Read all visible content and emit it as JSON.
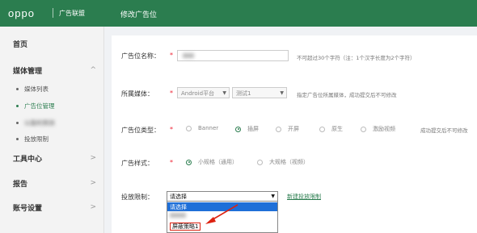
{
  "brand": {
    "logo": "oppo",
    "subtitle": "广告联盟"
  },
  "header": {
    "page_title": "修改广告位"
  },
  "sidebar": {
    "home": "首页",
    "media_mgmt": "媒体管理",
    "media_list": "媒体列表",
    "adpos_mgmt": "广告位管理",
    "blurred_item": "以盈利预测",
    "delivery_limit": "投放限制",
    "tools": "工具中心",
    "reports": "报告",
    "account": "账号设置",
    "chevron": ">",
    "chevron_up": "^"
  },
  "form": {
    "name_label": "广告位名称：",
    "name_hint": "不可超过30个字符（注：1个汉字长度为2个字符）",
    "media_label": "所属媒体：",
    "platform_value": "Android平台",
    "media_value": "测试1",
    "media_hint": "指定广告位所属媒体，成功提交后不可修改",
    "type_label": "广告位类型：",
    "type_options": [
      "Banner",
      "插屏",
      "开屏",
      "原生",
      "激励视频"
    ],
    "type_selected_index": 1,
    "type_hint": "成功提交后不可修改",
    "style_label": "广告样式：",
    "style_options": [
      "小规格（通用）",
      "大规格（视频）"
    ],
    "style_selected_index": 0,
    "limit_label": "投放限制：",
    "limit_select_value": "请选择",
    "limit_options": [
      "请选择",
      "",
      "屏蔽策略1"
    ],
    "new_limit_link": "新建投放限制",
    "required_mark": "*"
  },
  "colors": {
    "brand_green": "#2b7d4f",
    "highlight_blue": "#1e6fd8",
    "annotation_red": "#d21"
  }
}
